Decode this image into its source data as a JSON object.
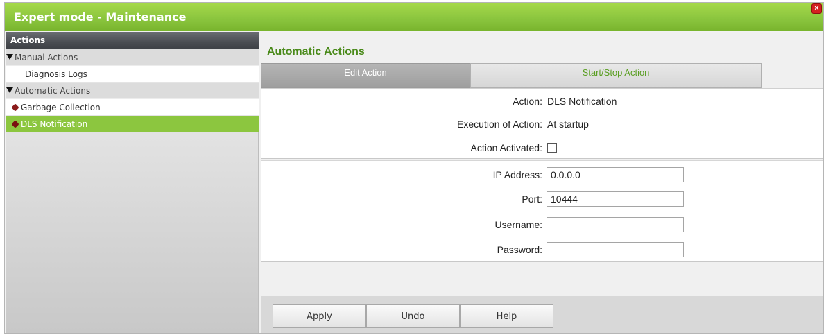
{
  "window": {
    "title": "Expert mode - Maintenance",
    "close_glyph": "×"
  },
  "sidebar": {
    "header": "Actions",
    "items": [
      {
        "label": "Manual Actions",
        "kind": "group"
      },
      {
        "label": "Diagnosis Logs",
        "kind": "leaf"
      },
      {
        "label": "Automatic Actions",
        "kind": "group"
      },
      {
        "label": "Garbage Collection",
        "kind": "leaf-dot"
      },
      {
        "label": "DLS Notification",
        "kind": "leaf-dot",
        "selected": true
      }
    ]
  },
  "main": {
    "heading": "Automatic Actions",
    "tabs": [
      {
        "label": "Edit Action",
        "active": true
      },
      {
        "label": "Start/Stop Action",
        "active": false
      }
    ],
    "info": {
      "action_label": "Action:",
      "action_value": "DLS Notification",
      "execution_label": "Execution of Action:",
      "execution_value": "At startup",
      "activated_label": "Action Activated:",
      "activated_checked": false
    },
    "fields": {
      "ip_label": "IP Address:",
      "ip_value": "0.0.0.0",
      "port_label": "Port:",
      "port_value": "10444",
      "username_label": "Username:",
      "username_value": "",
      "password_label": "Password:",
      "password_value": ""
    },
    "buttons": {
      "apply": "Apply",
      "undo": "Undo",
      "help": "Help"
    }
  },
  "colors": {
    "accent": "#8cc63f",
    "heading": "#4a8a1a",
    "close": "#d42020"
  }
}
